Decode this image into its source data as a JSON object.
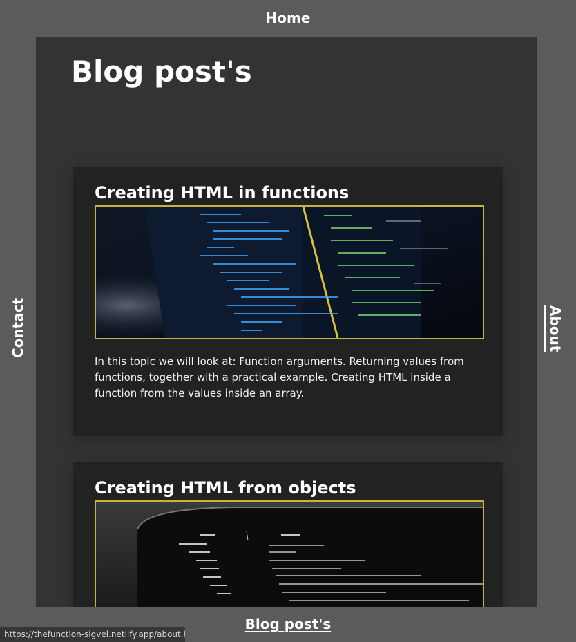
{
  "nav": {
    "home": "Home",
    "contact": "Contact",
    "about": "About",
    "blog": "Blog post's"
  },
  "main": {
    "page_title": "Blog post's",
    "posts": [
      {
        "title": "Creating HTML in functions",
        "image_icon": "code-editor-screenshot",
        "text": "In this topic we will look at: Function arguments. Returning values from functions, together with a practical example. Creating HTML inside a function from the values inside an array."
      },
      {
        "title": "Creating HTML from objects",
        "image_icon": "code-editor-screenshot",
        "text": ""
      }
    ]
  },
  "status_bar": {
    "url": "https://thefunction-sigvel.netlify.app/about.html"
  },
  "colors": {
    "background": "#5b5b5b",
    "panel": "#333333",
    "card": "#222222",
    "image_border": "#c9b43a"
  }
}
